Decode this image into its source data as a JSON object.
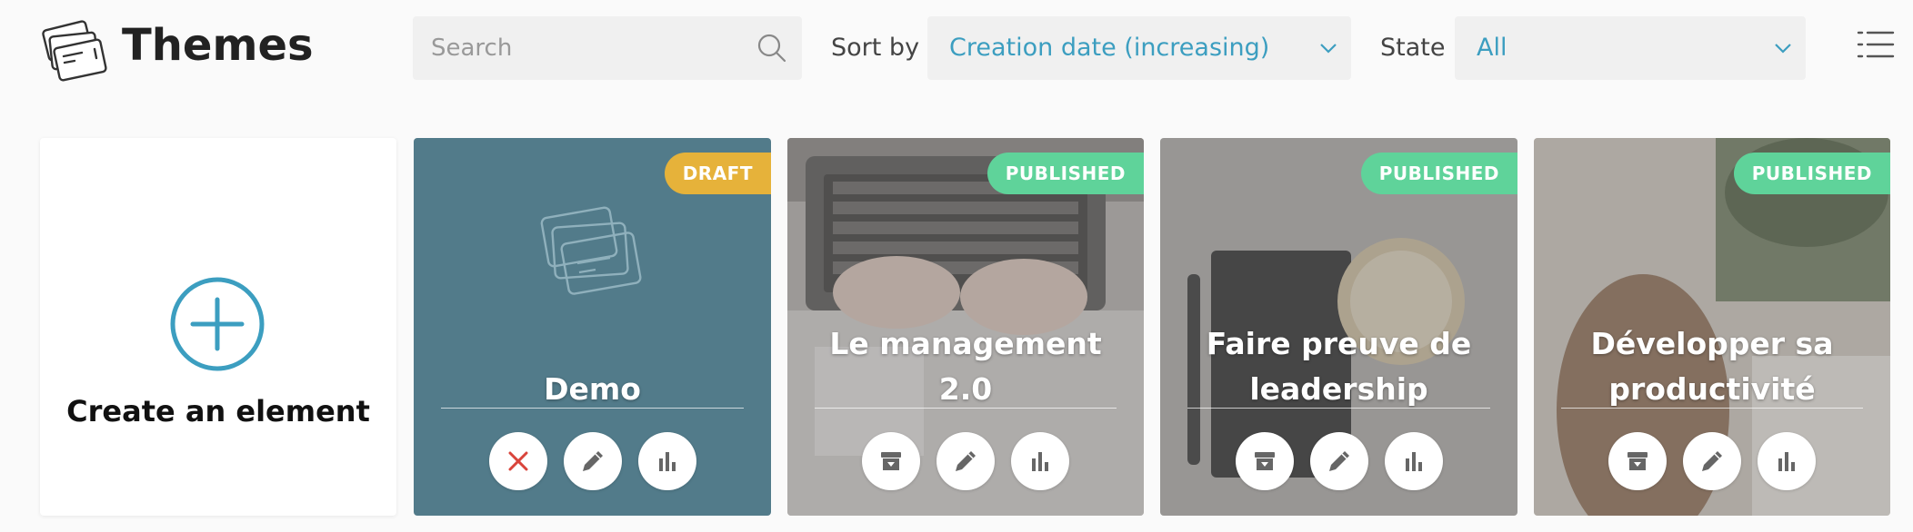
{
  "header": {
    "title": "Themes",
    "search_placeholder": "Search",
    "sort_label": "Sort by",
    "sort_value": "Creation date (increasing)",
    "state_label": "State",
    "state_value": "All"
  },
  "create": {
    "label": "Create an element"
  },
  "cards": [
    {
      "title": "Demo",
      "status": "DRAFT",
      "status_color": "#e6b23a",
      "image": "placeholder-theme-icon"
    },
    {
      "title": "Le management 2.0",
      "status": "PUBLISHED",
      "status_color": "#5fd39a",
      "image": "laptop-typing-photo"
    },
    {
      "title_line1": "Faire preuve de",
      "title_line2": "leadership",
      "status": "PUBLISHED",
      "status_color": "#5fd39a",
      "image": "notebook-coffee-photo"
    },
    {
      "title_line1": "Développer sa",
      "title_line2": "productivité",
      "status": "PUBLISHED",
      "status_color": "#5fd39a",
      "image": "woman-desk-photo"
    }
  ],
  "colors": {
    "accent": "#3c9ec0",
    "draft_card_bg": "#527b8a",
    "delete_red": "#d9443b"
  }
}
